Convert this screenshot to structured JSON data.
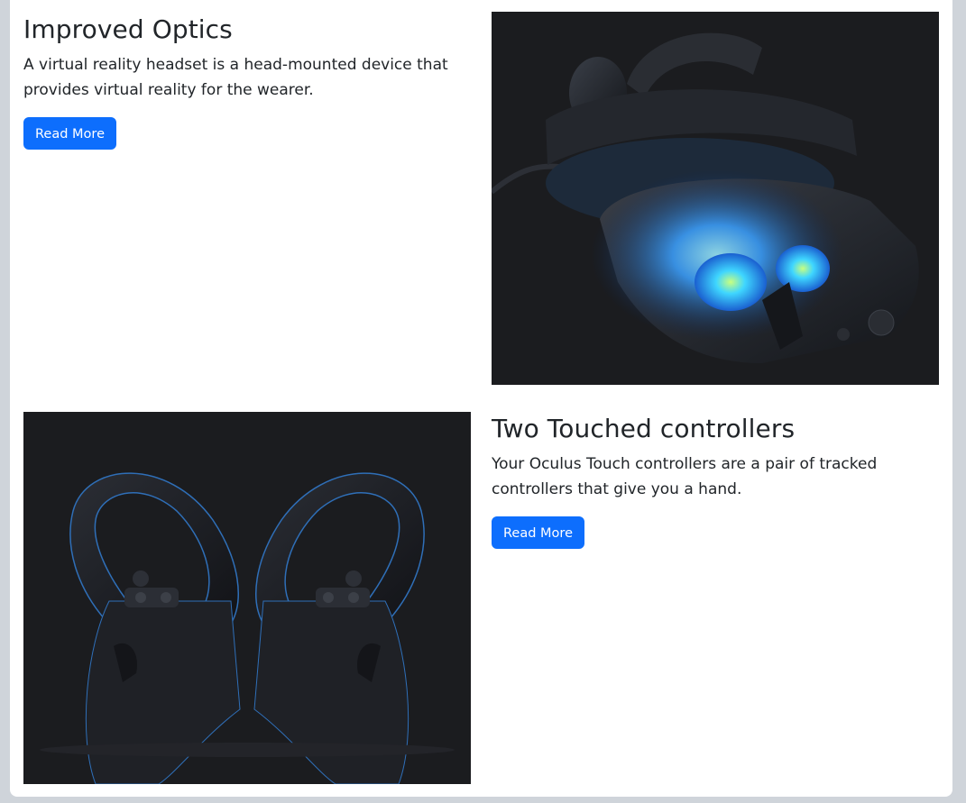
{
  "features": [
    {
      "title": "Improved Optics",
      "description": "A virtual reality headset is a head-mounted device that provides virtual reality for the wearer.",
      "button_label": "Read More",
      "image": "vr-headset-image"
    },
    {
      "title": "Two Touched controllers",
      "description": "Your Oculus Touch controllers are a pair of tracked controllers that give you a hand.",
      "button_label": "Read More",
      "image": "touch-controllers-image"
    }
  ],
  "colors": {
    "page_background": "#cfd4da",
    "card_background": "#ffffff",
    "button_primary": "#0d6efd",
    "image_background": "#1b1c1f",
    "glow": "#2a8cff"
  }
}
